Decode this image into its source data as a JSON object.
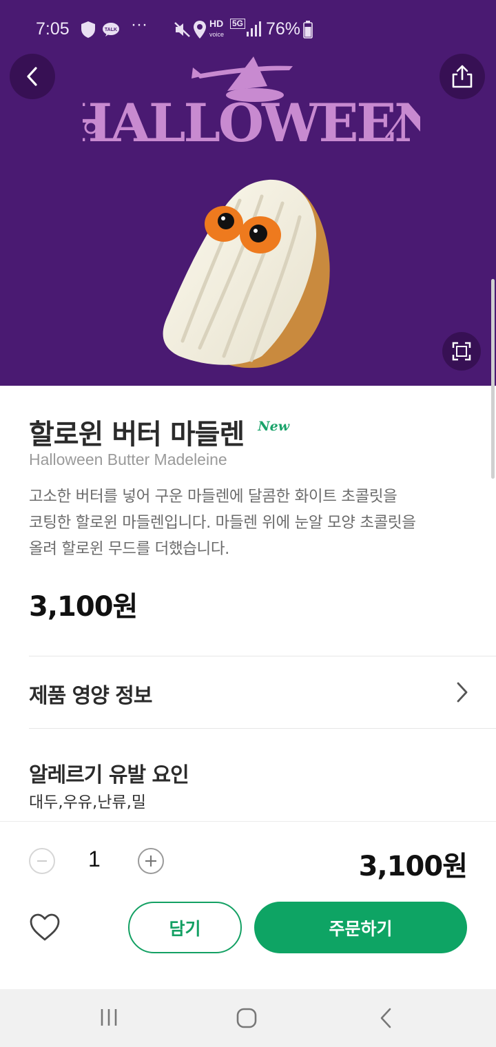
{
  "status_bar": {
    "time": "7:05",
    "talk_badge": "TALK",
    "more": "···",
    "hd_label": "HD",
    "voice_label": "voice",
    "network_label": "5G",
    "battery": "76%"
  },
  "hero": {
    "banner_text": "HALLOWEEN",
    "background_color": "#4a1a72",
    "icons": [
      "back-icon",
      "share-icon",
      "fullscreen-icon"
    ]
  },
  "product": {
    "name_ko": "할로윈 버터 마들렌",
    "badge": "New",
    "name_en": "Halloween Butter Madeleine",
    "description": [
      "고소한 버터를 넣어 구운 마들렌에 달콤한 화이트 초콜릿을",
      "코팅한 할로윈 마들렌입니다. 마들렌 위에 눈알 모양 초콜릿을",
      "올려 할로윈 무드를 더했습니다."
    ],
    "price": "3,100원"
  },
  "nutrition": {
    "label": "제품 영양 정보"
  },
  "allergy": {
    "title": "알레르기 유발 요인",
    "value": "대두,우유,난류,밀"
  },
  "order": {
    "quantity": "1",
    "total": "3,100원",
    "cart_label": "담기",
    "order_label": "주문하기",
    "accent_color": "#0ea464"
  }
}
